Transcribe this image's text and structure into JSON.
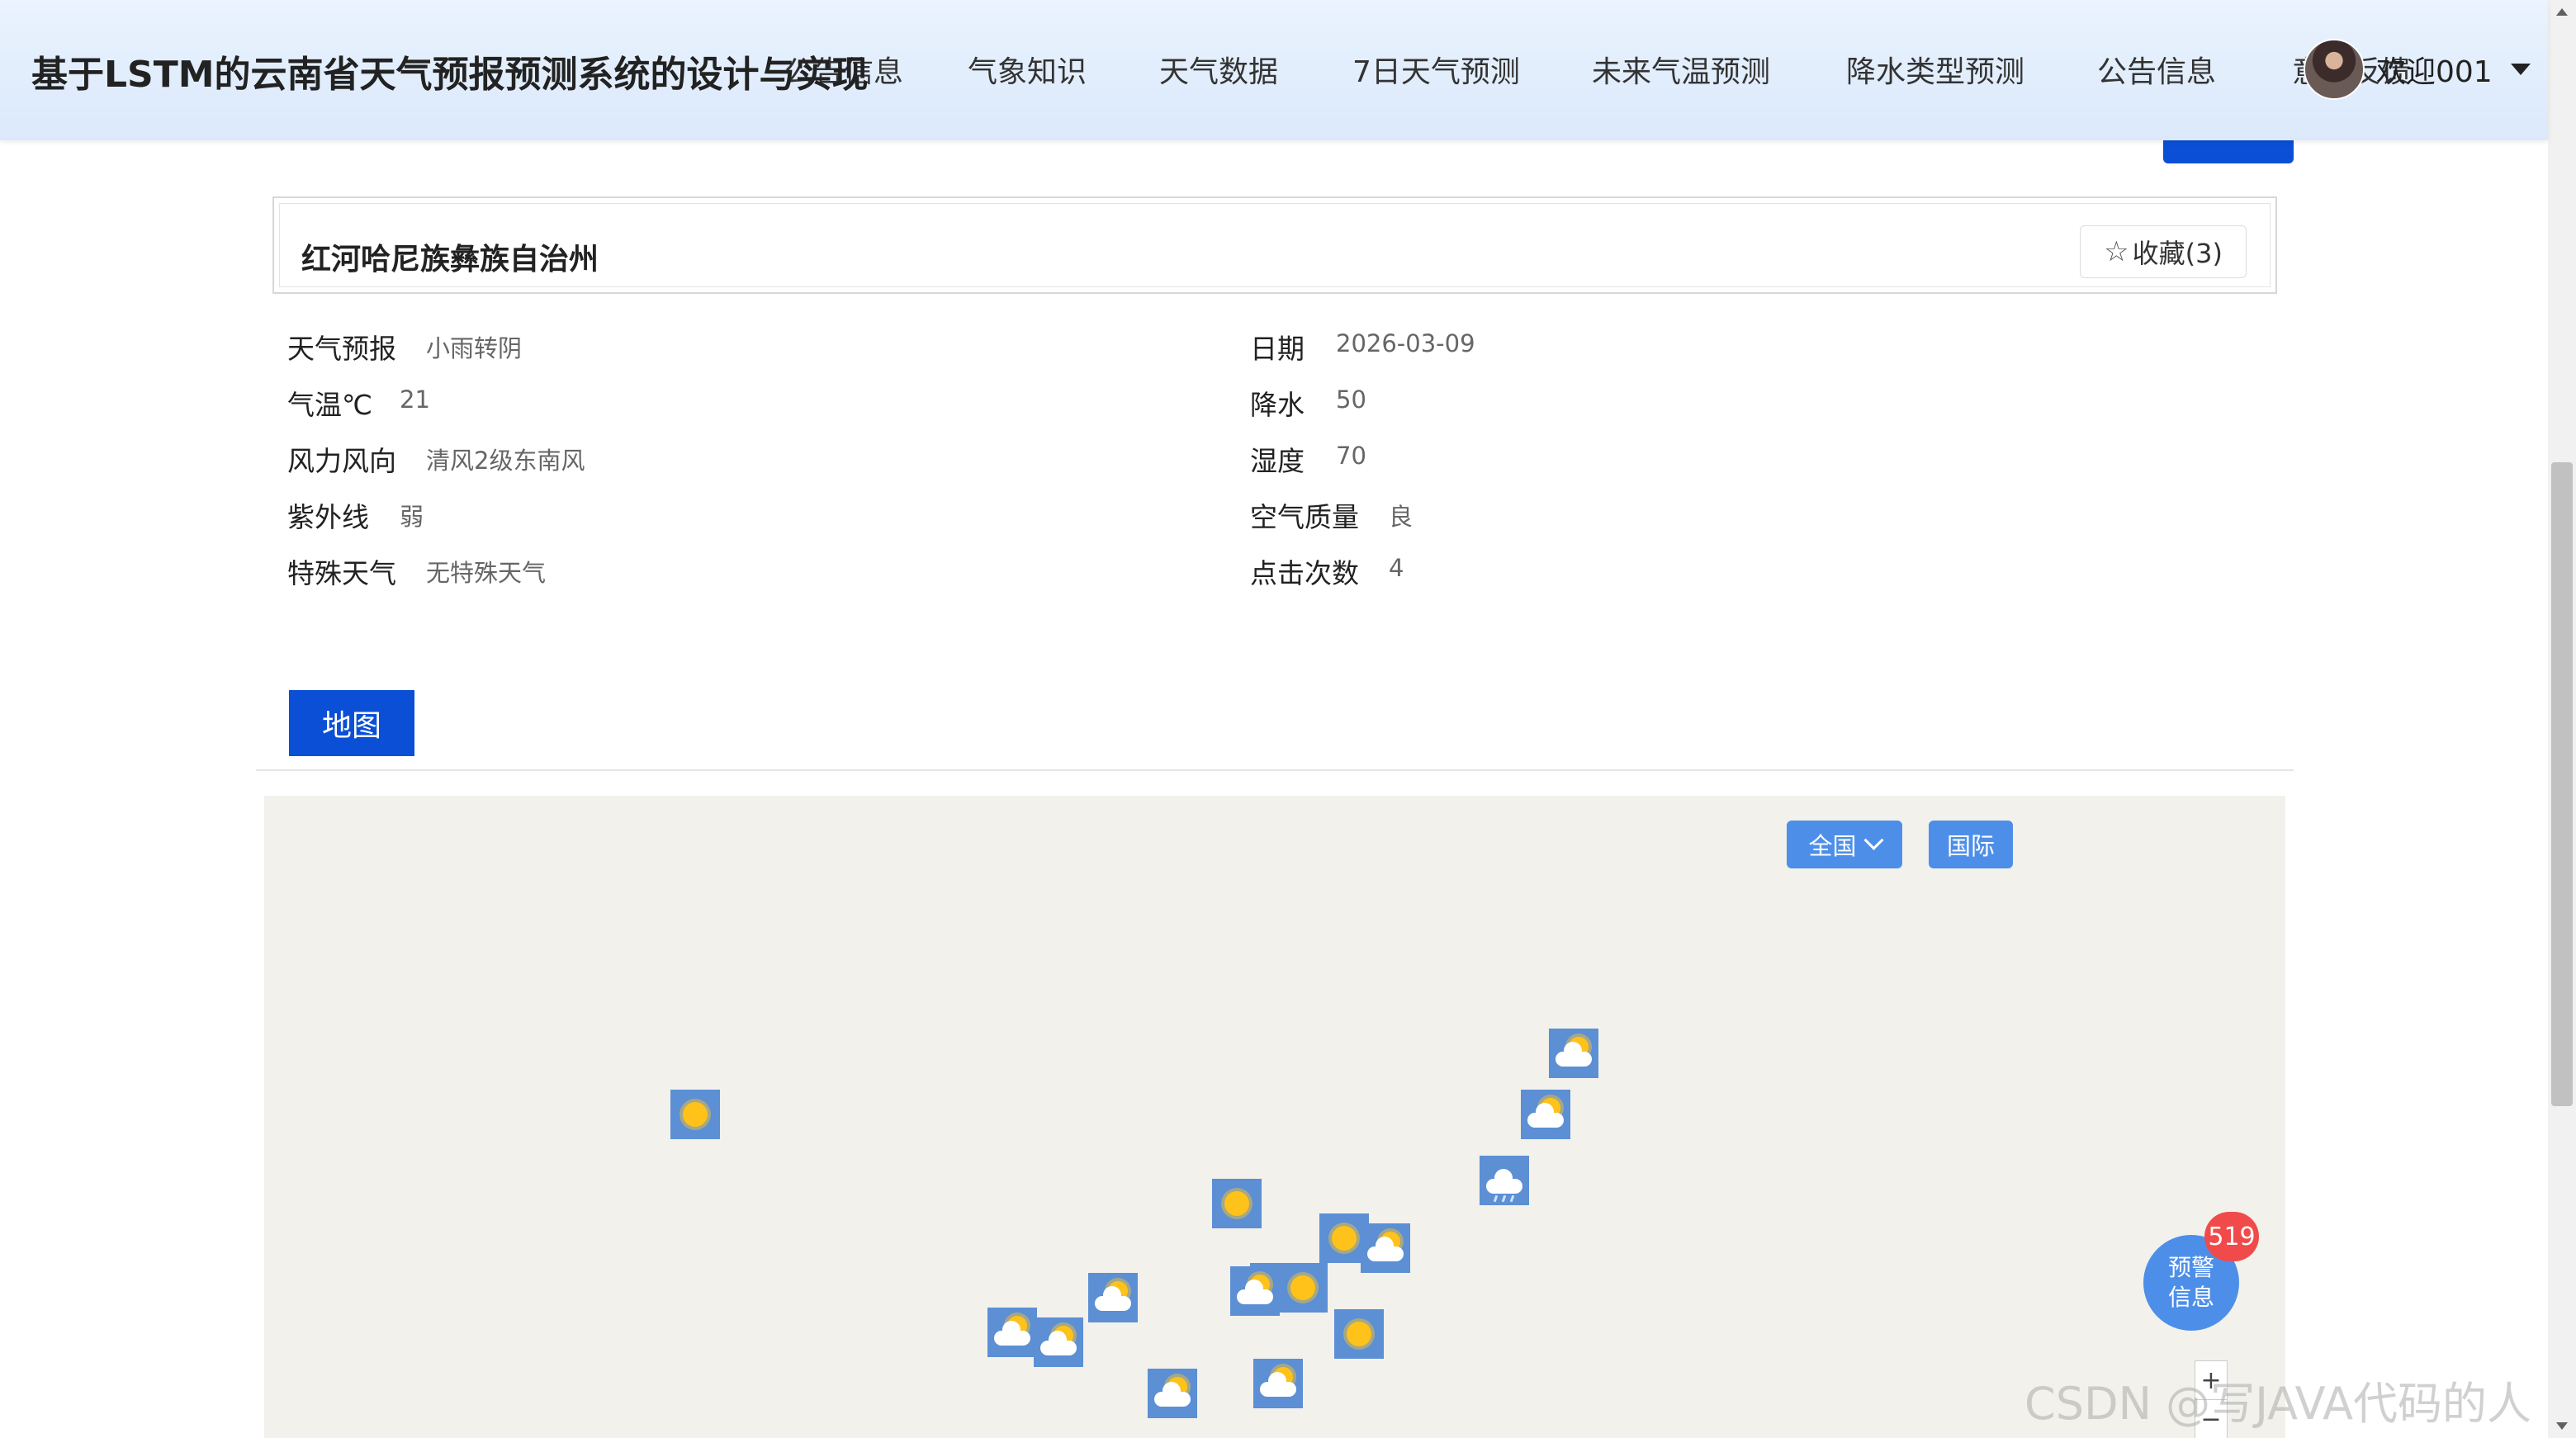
{
  "header": {
    "title": "基于LSTM的云南省天气预报预测系统的设计与实现",
    "nav": [
      "公告信息",
      "气象知识",
      "天气数据",
      "7日天气预测",
      "未来气温预测",
      "降水类型预测",
      "公告信息",
      "意见反馈"
    ],
    "user": "欢迎001"
  },
  "detail": {
    "name": "红河哈尼族彝族自治州",
    "favorite_label": "收藏(3)",
    "left": [
      {
        "label": "天气预报",
        "value": "小雨转阴"
      },
      {
        "label": "气温℃",
        "value": "21"
      },
      {
        "label": "风力风向",
        "value": "清风2级东南风"
      },
      {
        "label": "紫外线",
        "value": "弱"
      },
      {
        "label": "特殊天气",
        "value": "无特殊天气"
      }
    ],
    "right": [
      {
        "label": "日期",
        "value": "2026-03-09"
      },
      {
        "label": "降水",
        "value": "50"
      },
      {
        "label": "湿度",
        "value": "70"
      },
      {
        "label": "空气质量",
        "value": "良"
      },
      {
        "label": "点击次数",
        "value": "4"
      }
    ]
  },
  "tabs": {
    "map": "地图"
  },
  "map": {
    "region_select": "全国",
    "intl_button": "国际",
    "zoom_in": "+",
    "zoom_out": "−",
    "icons": [
      "sunny",
      "partly-cloudy",
      "partly-cloudy",
      "rain",
      "sunny",
      "sunny",
      "partly-cloudy",
      "partly-cloudy",
      "partly-cloudy",
      "sunny",
      "sunny",
      "partly-cloudy",
      "partly-cloudy",
      "partly-cloudy",
      "partly-cloudy",
      "partly-cloudy"
    ]
  },
  "warning": {
    "line1": "预警",
    "line2": "信息",
    "count": "519"
  },
  "watermark": "CSDN @写JAVA代码的人",
  "colors": {
    "primary": "#0b4fd6",
    "map_button": "#4d8fe8",
    "badge": "#f04a4a"
  }
}
